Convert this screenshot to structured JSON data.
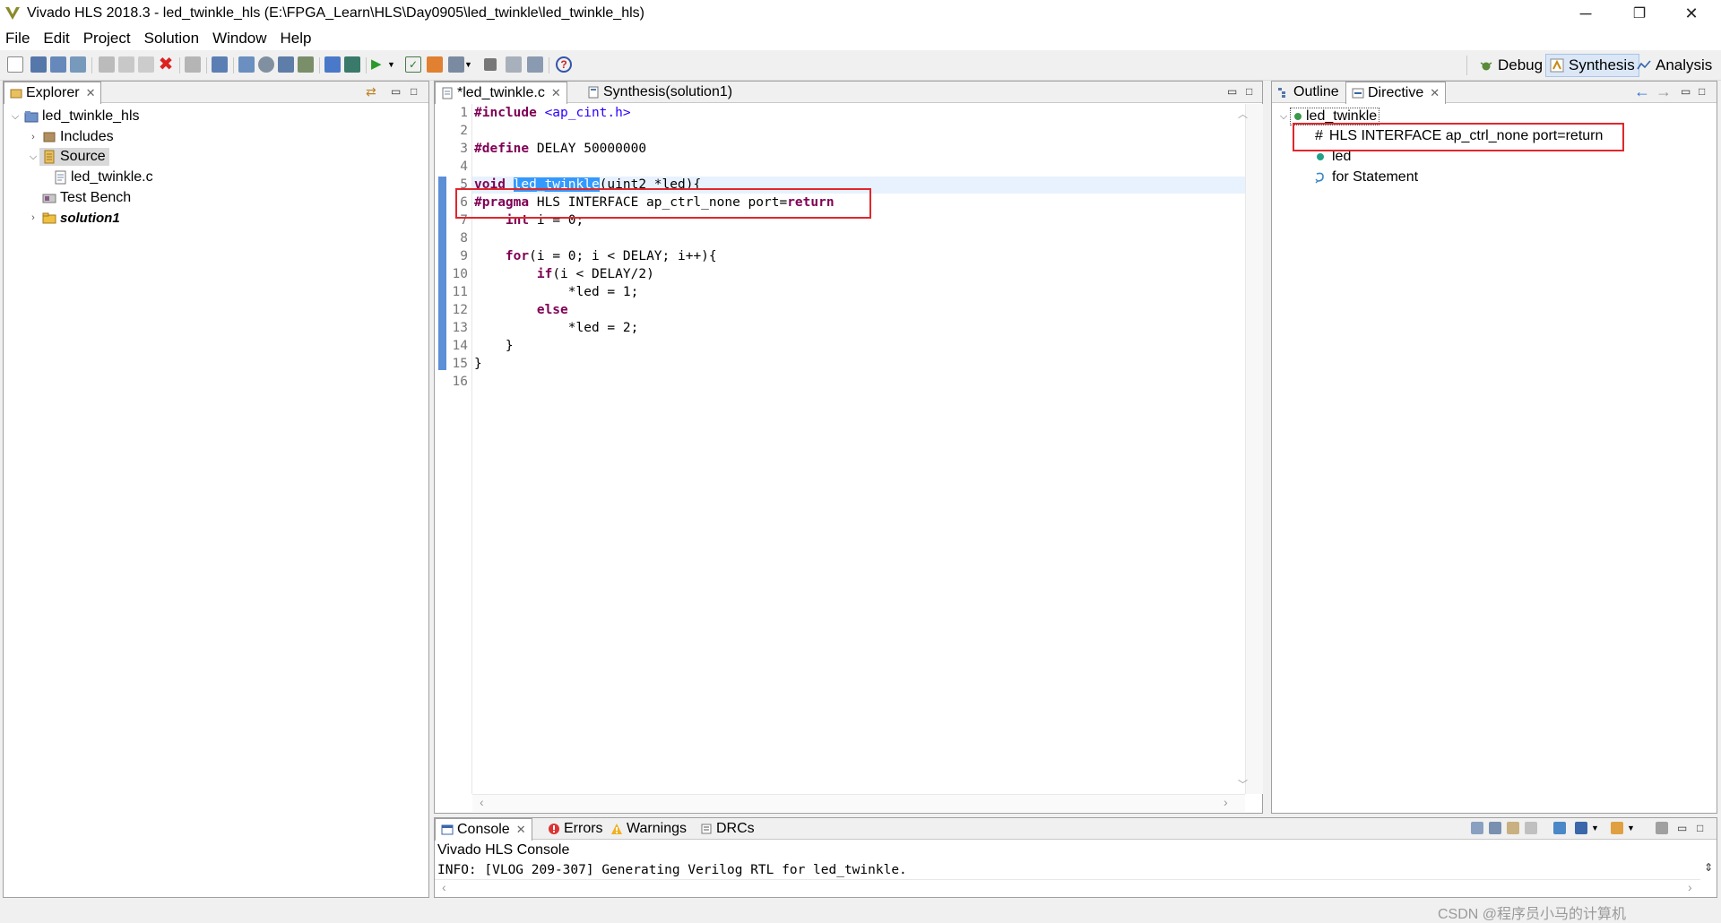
{
  "window": {
    "title": "Vivado HLS 2018.3 - led_twinkle_hls (E:\\FPGA_Learn\\HLS\\Day0905\\led_twinkle\\led_twinkle_hls)",
    "minimize": "─",
    "restore": "❐",
    "close": "✕"
  },
  "menu": [
    "File",
    "Edit",
    "Project",
    "Solution",
    "Window",
    "Help"
  ],
  "perspectives": {
    "debug": "Debug",
    "synthesis": "Synthesis",
    "analysis": "Analysis"
  },
  "explorer": {
    "tab_label": "Explorer",
    "tree": {
      "project": "led_twinkle_hls",
      "includes": "Includes",
      "source": "Source",
      "source_file": "led_twinkle.c",
      "test_bench": "Test Bench",
      "solution": "solution1"
    }
  },
  "editor": {
    "tabs": [
      "*led_twinkle.c",
      "Synthesis(solution1)"
    ],
    "line_numbers": [
      "1",
      "2",
      "3",
      "4",
      "5",
      "6",
      "7",
      "8",
      "9",
      "10",
      "11",
      "12",
      "13",
      "14",
      "15",
      "16"
    ]
  },
  "outline": {
    "tab_outline": "Outline",
    "tab_directive": "Directive",
    "tree": {
      "function": "led_twinkle",
      "directive": "HLS INTERFACE ap_ctrl_none port=return",
      "directive_prefix": "#",
      "port": "led",
      "loop": "for Statement"
    }
  },
  "console": {
    "tabs": [
      "Console",
      "Errors",
      "Warnings",
      "DRCs"
    ],
    "title": "Vivado HLS Console",
    "output": "INFO: [VLOG 209-307] Generating Verilog RTL for led_twinkle."
  },
  "watermark": "CSDN @程序员小马的计算机"
}
